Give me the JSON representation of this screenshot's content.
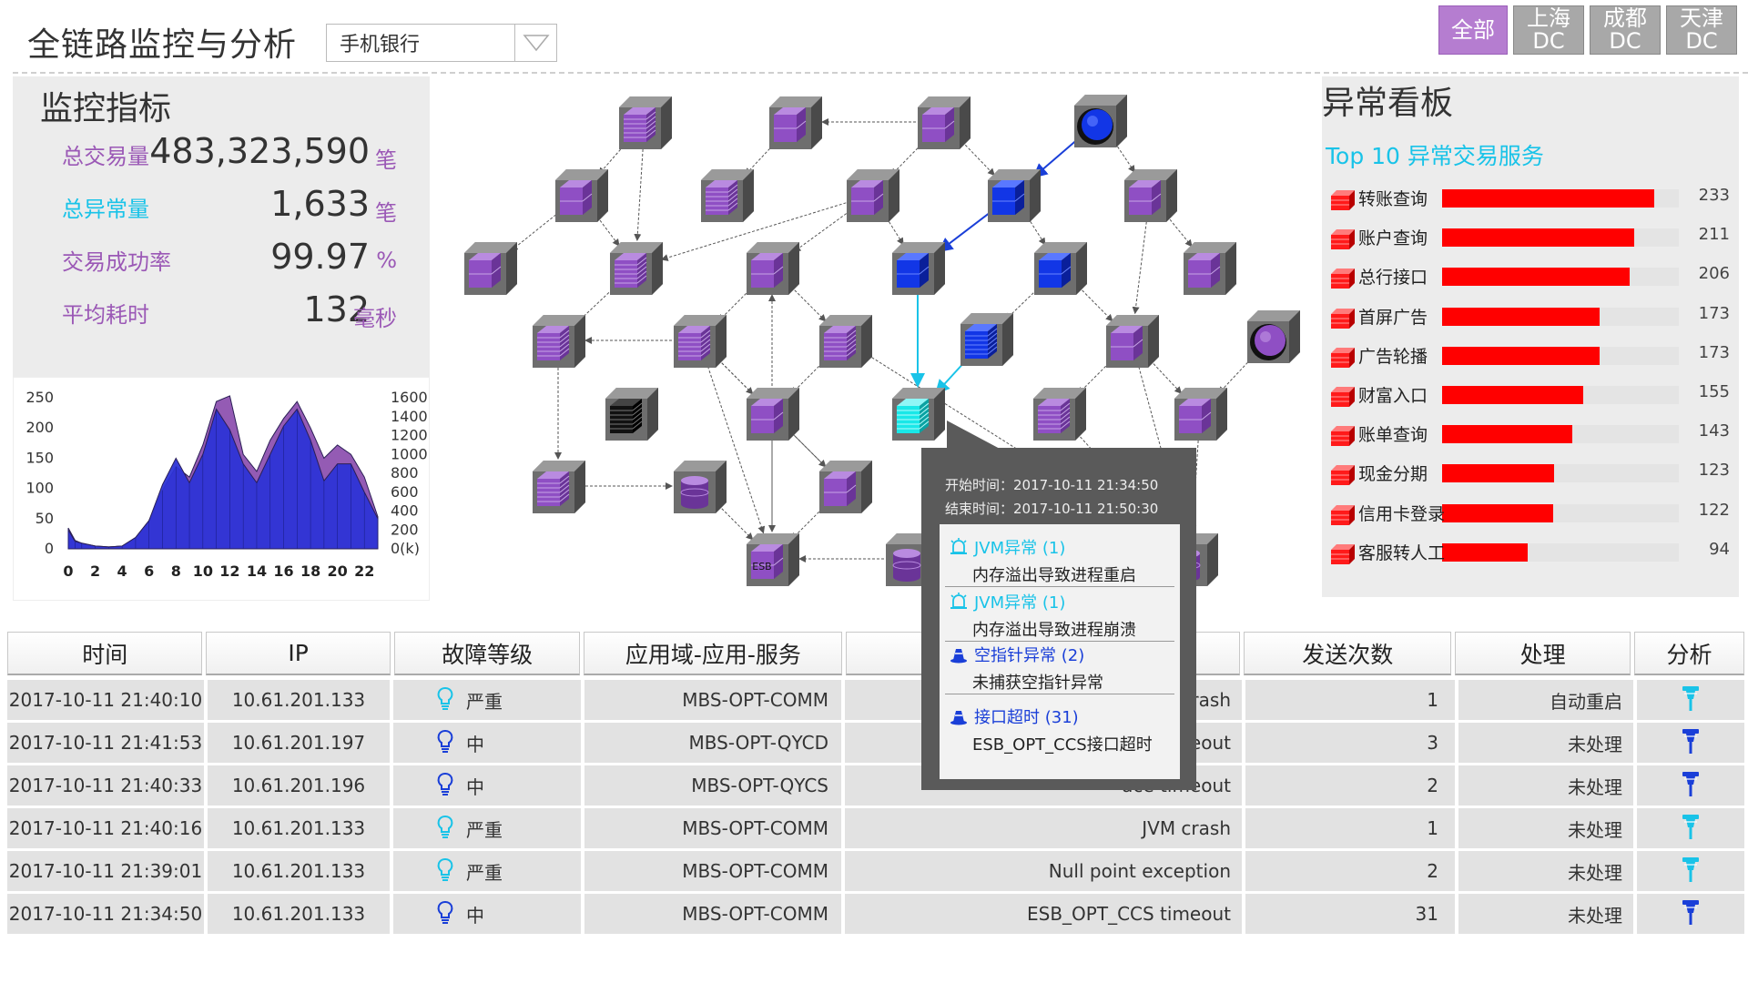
{
  "header": {
    "title": "全链路监控与分析",
    "app_select": "手机银行",
    "dc_buttons": [
      "全部",
      "上海\nDC",
      "成都\nDC",
      "天津\nDC"
    ]
  },
  "metrics": {
    "title": "监控指标",
    "items": [
      {
        "label": "总交易量",
        "value": "483,323,590",
        "unit": "笔",
        "color": "#9b59b6"
      },
      {
        "label": "总异常量",
        "value": "1,633",
        "unit": "笔",
        "color": "#19c3e8"
      },
      {
        "label": "交易成功率",
        "value": "99.97",
        "unit": "%",
        "color": "#9b59b6"
      },
      {
        "label": "平均耗时",
        "value": "132",
        "unit": "毫秒",
        "color": "#9b59b6"
      }
    ]
  },
  "chart_data": {
    "type": "area",
    "x_ticks": [
      "0",
      "2",
      "4",
      "6",
      "8",
      "10",
      "12",
      "14",
      "16",
      "18",
      "20",
      "22"
    ],
    "y_left_ticks": [
      "250",
      "200",
      "150",
      "100",
      "50",
      "0"
    ],
    "y_right_ticks": [
      "1600",
      "1400",
      "1200",
      "1000",
      "800",
      "600",
      "400",
      "200",
      "0(k)"
    ],
    "ylim_left": [
      0,
      250
    ],
    "ylim_right": [
      0,
      1600
    ],
    "x": [
      0,
      0.5,
      1,
      2,
      3,
      4,
      5,
      6,
      7,
      8,
      9,
      10,
      11,
      12,
      13,
      14,
      15,
      16,
      17,
      18,
      19,
      20,
      21,
      22,
      23
    ],
    "series": [
      {
        "color": "#2d34d6",
        "values": [
          200,
          80,
          60,
          30,
          20,
          30,
          120,
          300,
          680,
          960,
          700,
          1000,
          1480,
          1260,
          900,
          700,
          1000,
          1300,
          1480,
          1150,
          720,
          900,
          900,
          600,
          320
        ]
      },
      {
        "color": "#8e52b0",
        "values": [
          220,
          90,
          60,
          30,
          20,
          30,
          120,
          300,
          620,
          870,
          760,
          1100,
          1560,
          1620,
          1000,
          820,
          1150,
          1380,
          1560,
          1280,
          960,
          1100,
          1000,
          760,
          340
        ]
      }
    ]
  },
  "anomaly": {
    "title": "异常看板",
    "subtitle": "Top 10 异常交易服务",
    "max": 260,
    "items": [
      {
        "name": "转账查询",
        "value": 233
      },
      {
        "name": "账户查询",
        "value": 211
      },
      {
        "name": "总行接口",
        "value": 206
      },
      {
        "name": "首屏广告",
        "value": 173
      },
      {
        "name": "广告轮播",
        "value": 173
      },
      {
        "name": "财富入口",
        "value": 155
      },
      {
        "name": "账单查询",
        "value": 143
      },
      {
        "name": "现金分期",
        "value": 123
      },
      {
        "name": "信用卡登录",
        "value": 122
      },
      {
        "name": "客服转人工",
        "value": 94
      }
    ]
  },
  "tooltip": {
    "start": "开始时间：2017-10-11 21:34:50",
    "end": "结束时间：2017-10-11 21:50:30",
    "items": [
      {
        "title": "JVM异常 (1)",
        "desc": "内存溢出导致进程重启",
        "color": "#19c3e8"
      },
      {
        "title": "JVM异常 (1)",
        "desc": "内存溢出导致进程崩溃",
        "color": "#19c3e8"
      },
      {
        "title": "空指针异常 (2)",
        "desc": "未捕获空指针异常",
        "color": "#1a3fd8"
      },
      {
        "title": "接口超时  (31)",
        "desc": "ESB_OPT_CCS接口超时",
        "color": "#1a3fd8"
      }
    ]
  },
  "topology": {
    "esb_label": "ESB"
  },
  "table": {
    "headers": [
      "时间",
      "IP",
      "故障等级",
      "应用域-应用-服务",
      "",
      "发送次数",
      "处理",
      "分析"
    ],
    "rows": [
      {
        "time": "2017-10-11 21:40:10",
        "ip": "10.61.201.133",
        "level": "严重",
        "service": "MBS-OPT-COMM",
        "desc": "M crash",
        "count": "1",
        "action": "自动重启",
        "severity": "high"
      },
      {
        "time": "2017-10-11 21:41:53",
        "ip": "10.61.201.197",
        "level": "中",
        "service": "MBS-OPT-QYCD",
        "desc": "imeout",
        "count": "3",
        "action": "未处理",
        "severity": "mid"
      },
      {
        "time": "2017-10-11 21:40:33",
        "ip": "10.61.201.196",
        "level": "中",
        "service": "MBS-OPT-QYCS",
        "desc": "ace timeout",
        "count": "2",
        "action": "未处理",
        "severity": "mid"
      },
      {
        "time": "2017-10-11 21:40:16",
        "ip": "10.61.201.133",
        "level": "严重",
        "service": "MBS-OPT-COMM",
        "desc": "JVM crash",
        "count": "1",
        "action": "未处理",
        "severity": "high"
      },
      {
        "time": "2017-10-11 21:39:01",
        "ip": "10.61.201.133",
        "level": "严重",
        "service": "MBS-OPT-COMM",
        "desc": "Null point exception",
        "count": "2",
        "action": "未处理",
        "severity": "high"
      },
      {
        "time": "2017-10-11 21:34:50",
        "ip": "10.61.201.133",
        "level": "中",
        "service": "MBS-OPT-COMM",
        "desc": "ESB_OPT_CCS timeout",
        "count": "31",
        "action": "未处理",
        "severity": "mid"
      }
    ]
  }
}
